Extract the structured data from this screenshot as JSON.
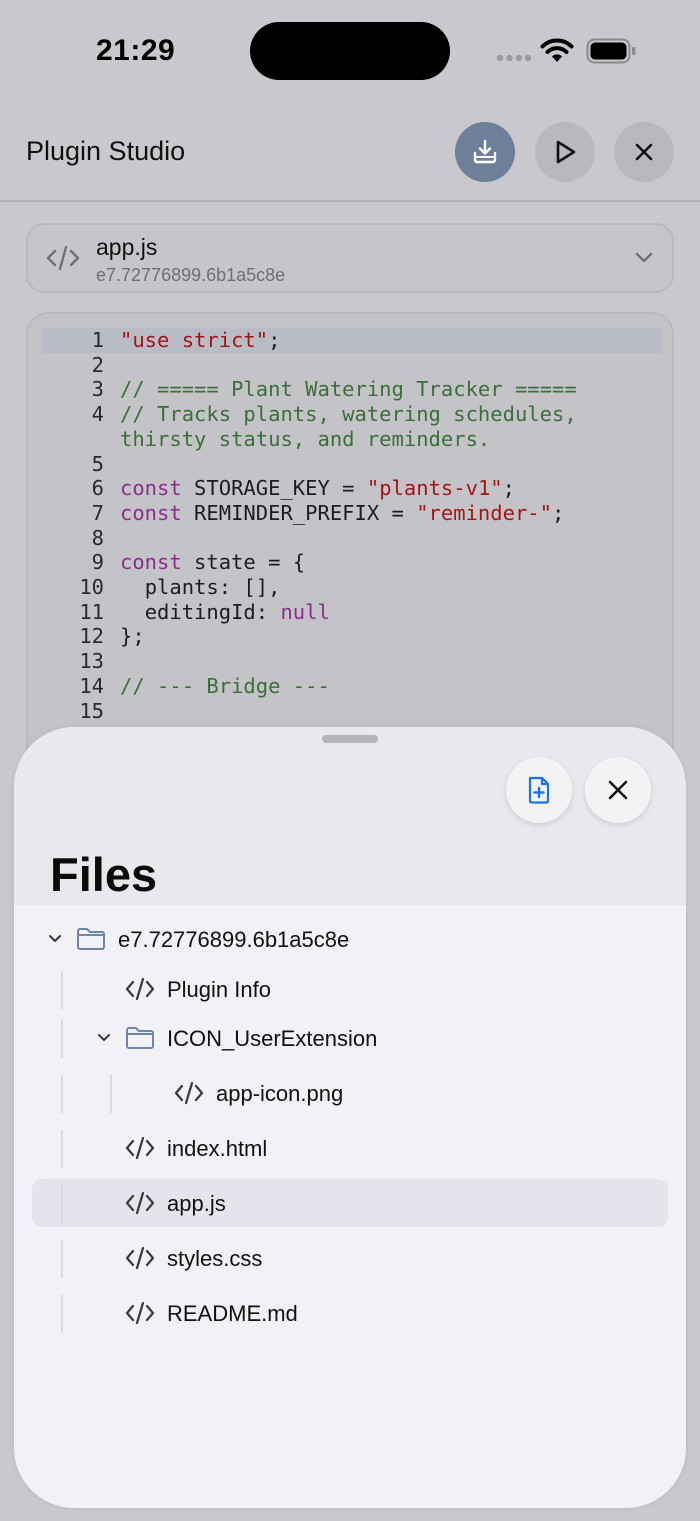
{
  "status_bar": {
    "time": "21:29"
  },
  "header": {
    "title": "Plugin Studio",
    "buttons": [
      "download-icon",
      "play-icon",
      "close-icon"
    ]
  },
  "file_selector": {
    "name": "app.js",
    "id": "e7.72776899.6b1a5c8e"
  },
  "code": {
    "lines": [
      {
        "n": "1",
        "parts": [
          {
            "t": "\"use strict\"",
            "c": "str"
          },
          {
            "t": ";",
            "c": ""
          }
        ]
      },
      {
        "n": "2",
        "parts": []
      },
      {
        "n": "3",
        "parts": [
          {
            "t": "// ===== Plant Watering Tracker =====",
            "c": "com"
          }
        ]
      },
      {
        "n": "4",
        "parts": [
          {
            "t": "// Tracks plants, watering schedules, thirsty status, and reminders.",
            "c": "com"
          }
        ]
      },
      {
        "n": "5",
        "parts": []
      },
      {
        "n": "6",
        "parts": [
          {
            "t": "const",
            "c": "kw"
          },
          {
            "t": " STORAGE_KEY = ",
            "c": ""
          },
          {
            "t": "\"plants-v1\"",
            "c": "str"
          },
          {
            "t": ";",
            "c": ""
          }
        ]
      },
      {
        "n": "7",
        "parts": [
          {
            "t": "const",
            "c": "kw"
          },
          {
            "t": " REMINDER_PREFIX = ",
            "c": ""
          },
          {
            "t": "\"reminder-\"",
            "c": "str"
          },
          {
            "t": ";",
            "c": ""
          }
        ]
      },
      {
        "n": "8",
        "parts": []
      },
      {
        "n": "9",
        "parts": [
          {
            "t": "const",
            "c": "kw"
          },
          {
            "t": " state = {",
            "c": ""
          }
        ]
      },
      {
        "n": "10",
        "parts": [
          {
            "t": "  plants: [],",
            "c": ""
          }
        ]
      },
      {
        "n": "11",
        "parts": [
          {
            "t": "  editingId: ",
            "c": ""
          },
          {
            "t": "null",
            "c": "kw"
          }
        ]
      },
      {
        "n": "12",
        "parts": [
          {
            "t": "};",
            "c": ""
          }
        ]
      },
      {
        "n": "13",
        "parts": []
      },
      {
        "n": "14",
        "parts": [
          {
            "t": "// --- Bridge ---",
            "c": "com"
          }
        ]
      },
      {
        "n": "15",
        "parts": []
      }
    ]
  },
  "files_sheet": {
    "title": "Files",
    "tree": [
      {
        "label": "e7.72776899.6b1a5c8e",
        "icon": "folder-icon",
        "chevron": true,
        "depth": 0,
        "selected": false
      },
      {
        "label": "Plugin Info",
        "icon": "code-icon",
        "chevron": false,
        "depth": 1,
        "selected": false
      },
      {
        "label": "ICON_UserExtension",
        "icon": "folder-icon",
        "chevron": true,
        "depth": 1,
        "selected": false
      },
      {
        "label": "app-icon.png",
        "icon": "code-icon",
        "chevron": false,
        "depth": 2,
        "selected": false
      },
      {
        "label": "index.html",
        "icon": "code-icon",
        "chevron": false,
        "depth": 1,
        "selected": false
      },
      {
        "label": "app.js",
        "icon": "code-icon",
        "chevron": false,
        "depth": 1,
        "selected": true
      },
      {
        "label": "styles.css",
        "icon": "code-icon",
        "chevron": false,
        "depth": 1,
        "selected": false
      },
      {
        "label": "README.md",
        "icon": "code-icon",
        "chevron": false,
        "depth": 1,
        "selected": false
      }
    ]
  },
  "colors": {
    "accent": "#1a73e8",
    "primary_button": "#6e7f9a",
    "string": "#a31515",
    "comment": "#3b6e3b",
    "keyword": "#8b2d8b"
  }
}
